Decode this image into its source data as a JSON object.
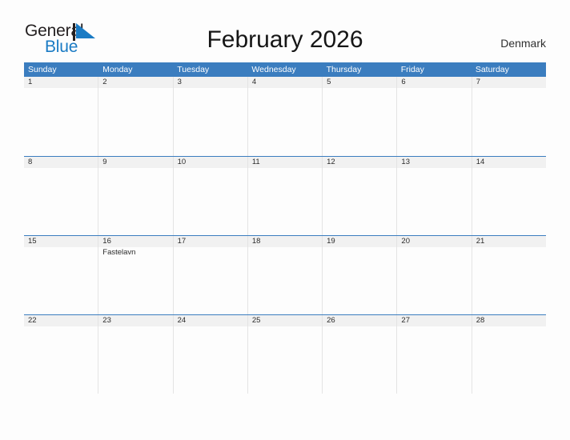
{
  "logo": {
    "line1": "General",
    "line2": "Blue",
    "mark": "flag-triangle-icon",
    "color_dark": "#231f20",
    "color_blue": "#1a7bc4"
  },
  "header": {
    "title": "February 2026",
    "country": "Denmark"
  },
  "colors": {
    "header_blue": "#3b7dbf",
    "row_divider_blue": "#3b7dbf",
    "date_band_gray": "#f1f1f1",
    "page_background": "#fdfdfd",
    "text": "#2b2b2b"
  },
  "calendar": {
    "month": "February",
    "year": "2026",
    "weekdays": [
      "Sunday",
      "Monday",
      "Tuesday",
      "Wednesday",
      "Thursday",
      "Friday",
      "Saturday"
    ],
    "weeks": [
      [
        {
          "date": "1",
          "events": []
        },
        {
          "date": "2",
          "events": []
        },
        {
          "date": "3",
          "events": []
        },
        {
          "date": "4",
          "events": []
        },
        {
          "date": "5",
          "events": []
        },
        {
          "date": "6",
          "events": []
        },
        {
          "date": "7",
          "events": []
        }
      ],
      [
        {
          "date": "8",
          "events": []
        },
        {
          "date": "9",
          "events": []
        },
        {
          "date": "10",
          "events": []
        },
        {
          "date": "11",
          "events": []
        },
        {
          "date": "12",
          "events": []
        },
        {
          "date": "13",
          "events": []
        },
        {
          "date": "14",
          "events": []
        }
      ],
      [
        {
          "date": "15",
          "events": []
        },
        {
          "date": "16",
          "events": [
            "Fastelavn"
          ]
        },
        {
          "date": "17",
          "events": []
        },
        {
          "date": "18",
          "events": []
        },
        {
          "date": "19",
          "events": []
        },
        {
          "date": "20",
          "events": []
        },
        {
          "date": "21",
          "events": []
        }
      ],
      [
        {
          "date": "22",
          "events": []
        },
        {
          "date": "23",
          "events": []
        },
        {
          "date": "24",
          "events": []
        },
        {
          "date": "25",
          "events": []
        },
        {
          "date": "26",
          "events": []
        },
        {
          "date": "27",
          "events": []
        },
        {
          "date": "28",
          "events": []
        }
      ]
    ]
  }
}
